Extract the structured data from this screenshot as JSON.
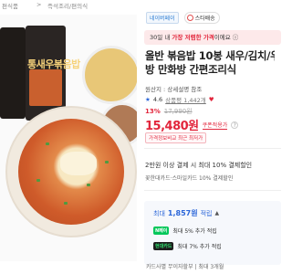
{
  "breadcrumb": {
    "left": "편식품",
    "sep": ">",
    "right": "즉석조리/편의식"
  },
  "badges": {
    "pay": "네이버페이",
    "delivery": "스타배송"
  },
  "promo": {
    "prefix": "30일 내",
    "highlight": "가장 저렴한 가격",
    "suffix": "이에요 ⓘ"
  },
  "product": {
    "title_line1": "올반 볶음밥 10봉 새우/김치/우",
    "title_line2": "방 만화방 간편조리식",
    "origin": "원산지 : 상세설명 참조",
    "rating": "4.6",
    "review_link": "상품평 1,442개",
    "heart": "♥"
  },
  "pricing": {
    "discount": "13%",
    "original": "17,990원",
    "price": "15,480원",
    "coupon": "쿠폰적용가",
    "coupon_info": "?",
    "lowest_badge": "가격정보비교 최근 최저가"
  },
  "shipping": {
    "line1": "2만원 이상 결제 시 최대 10% 결제할인",
    "line2": "꽃한대카드·스마일카드 10% 결제할인"
  },
  "points": {
    "head_label": "최대",
    "head_value": "1,857원",
    "head_suffix": "적립",
    "caret": "▲",
    "row1_tag": "N페이",
    "row1_text": "최대 5% 추가 적립",
    "row2_tag": "현대카드",
    "row2_text": "최대 7% 추가 적립"
  },
  "card": {
    "text": "카드사별 무이자할부 | 최대 3개월"
  },
  "image": {
    "package_label": "통새우볶음밥"
  },
  "colors": {
    "accent": "#e2263c",
    "blue": "#2b66d9",
    "promo_bg": "#fde9ea"
  }
}
